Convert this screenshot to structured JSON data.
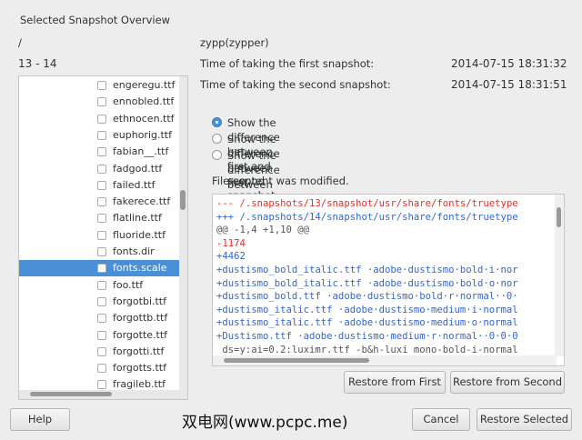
{
  "title": "Selected Snapshot Overview",
  "path": "/",
  "snapshot_range": "13 - 14",
  "files": [
    "engeregu.ttf",
    "ennobled.ttf",
    "ethnocen.ttf",
    "euphorig.ttf",
    "fabian__.ttf",
    "fadgod.ttf",
    "failed.ttf",
    "fakerece.ttf",
    "flatline.ttf",
    "fluoride.ttf",
    "fonts.dir",
    "fonts.scale",
    "foo.ttf",
    "forgotbi.ttf",
    "forgottb.ttf",
    "forgotte.ttf",
    "forgotti.ttf",
    "forgotts.ttf",
    "fragileb.ttf"
  ],
  "selected_file": "fonts.scale",
  "info": {
    "name": "zypp(zypper)",
    "first_label": "Time of taking the first snapshot:",
    "first_time": "2014-07-15 18:31:32",
    "second_label": "Time of taking the second snapshot:",
    "second_time": "2014-07-15 18:31:51"
  },
  "radios": [
    {
      "label": "Show the difference between first and second snapshot",
      "checked": true
    },
    {
      "label": "Show the difference between first snapshot and current system",
      "checked": false
    },
    {
      "label": "Show the difference between second snapshot and current system",
      "checked": false
    }
  ],
  "status": "File content was modified.",
  "diff": [
    {
      "type": "del",
      "text": "--- /.snapshots/13/snapshot/usr/share/fonts/truetype"
    },
    {
      "type": "add",
      "text": "+++ /.snapshots/14/snapshot/usr/share/fonts/truetype"
    },
    {
      "type": "ctx",
      "text": "@@ -1,4 +1,10 @@"
    },
    {
      "type": "del",
      "text": "-1174"
    },
    {
      "type": "add",
      "text": "+4462"
    },
    {
      "type": "add",
      "text": "+dustismo_bold_italic.ttf ·adobe·dustismo·bold·i·nor"
    },
    {
      "type": "add",
      "text": "+dustismo_bold_italic.ttf ·adobe·dustismo·bold·o·nor"
    },
    {
      "type": "add",
      "text": "+dustismo_bold.ttf ·adobe·dustismo·bold·r·normal··0·"
    },
    {
      "type": "add",
      "text": "+dustismo_italic.ttf ·adobe·dustismo·medium·i·normal"
    },
    {
      "type": "add",
      "text": "+dustismo_italic.ttf ·adobe·dustismo·medium·o·normal"
    },
    {
      "type": "add",
      "text": "+Dustismo.ttf ·adobe·dustismo·medium·r·normal··0·0·0"
    },
    {
      "type": "ctx",
      "text": " ds=y:ai=0.2:luximr.ttf -b&h-luxi mono-bold-i-normal"
    }
  ],
  "buttons": {
    "restore_first": "Restore from First",
    "restore_second": "Restore from Second",
    "help": "Help",
    "cancel": "Cancel",
    "restore_selected": "Restore Selected"
  },
  "watermark": "双电网(www.pcpc.me)"
}
